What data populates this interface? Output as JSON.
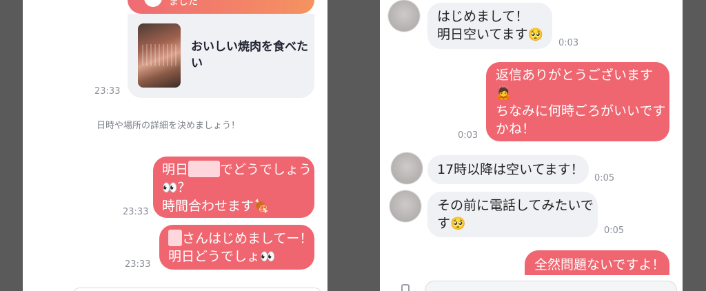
{
  "left": {
    "banner_text": "ました",
    "card_title_line1": "おいしい焼肉を食べた",
    "card_title_line2": "い",
    "card_time": "23:33",
    "system_message": "日時や場所の詳細を決めましょう！",
    "msg1": {
      "l1a": "明日",
      "l1b": "でどうでしょう",
      "l2a": "👀",
      "l2b": "？",
      "l3a": "時間合わせます",
      "l3b": "🍖",
      "time": "23:33"
    },
    "msg2": {
      "l1": "さんはじめましてー！",
      "l2a": "明日どうでしょ",
      "l2b": "👀",
      "time": "23:33"
    }
  },
  "right": {
    "messages": [
      {
        "l1": "はじめまして！",
        "l2a": "明日空いてます",
        "l2b": "🥺",
        "time": "0:03"
      },
      {
        "l1": "返信ありがとうございます",
        "l2": "🙇",
        "l3": "ちなみに何時ごろがいいです",
        "l4": "かね！",
        "time": "0:03"
      },
      {
        "l1": "17時以降は空いてます！",
        "time": "0:05"
      },
      {
        "l1": "その前に電話してみたいで",
        "l2a": "す",
        "l2b": "🥺",
        "time": "0:05"
      },
      {
        "l1": "全然問題ないですよ！"
      }
    ]
  },
  "colors": {
    "outgoing_bubble": "#ef6670",
    "incoming_bubble": "#f0f1f4",
    "background": "#5a5a5a"
  }
}
